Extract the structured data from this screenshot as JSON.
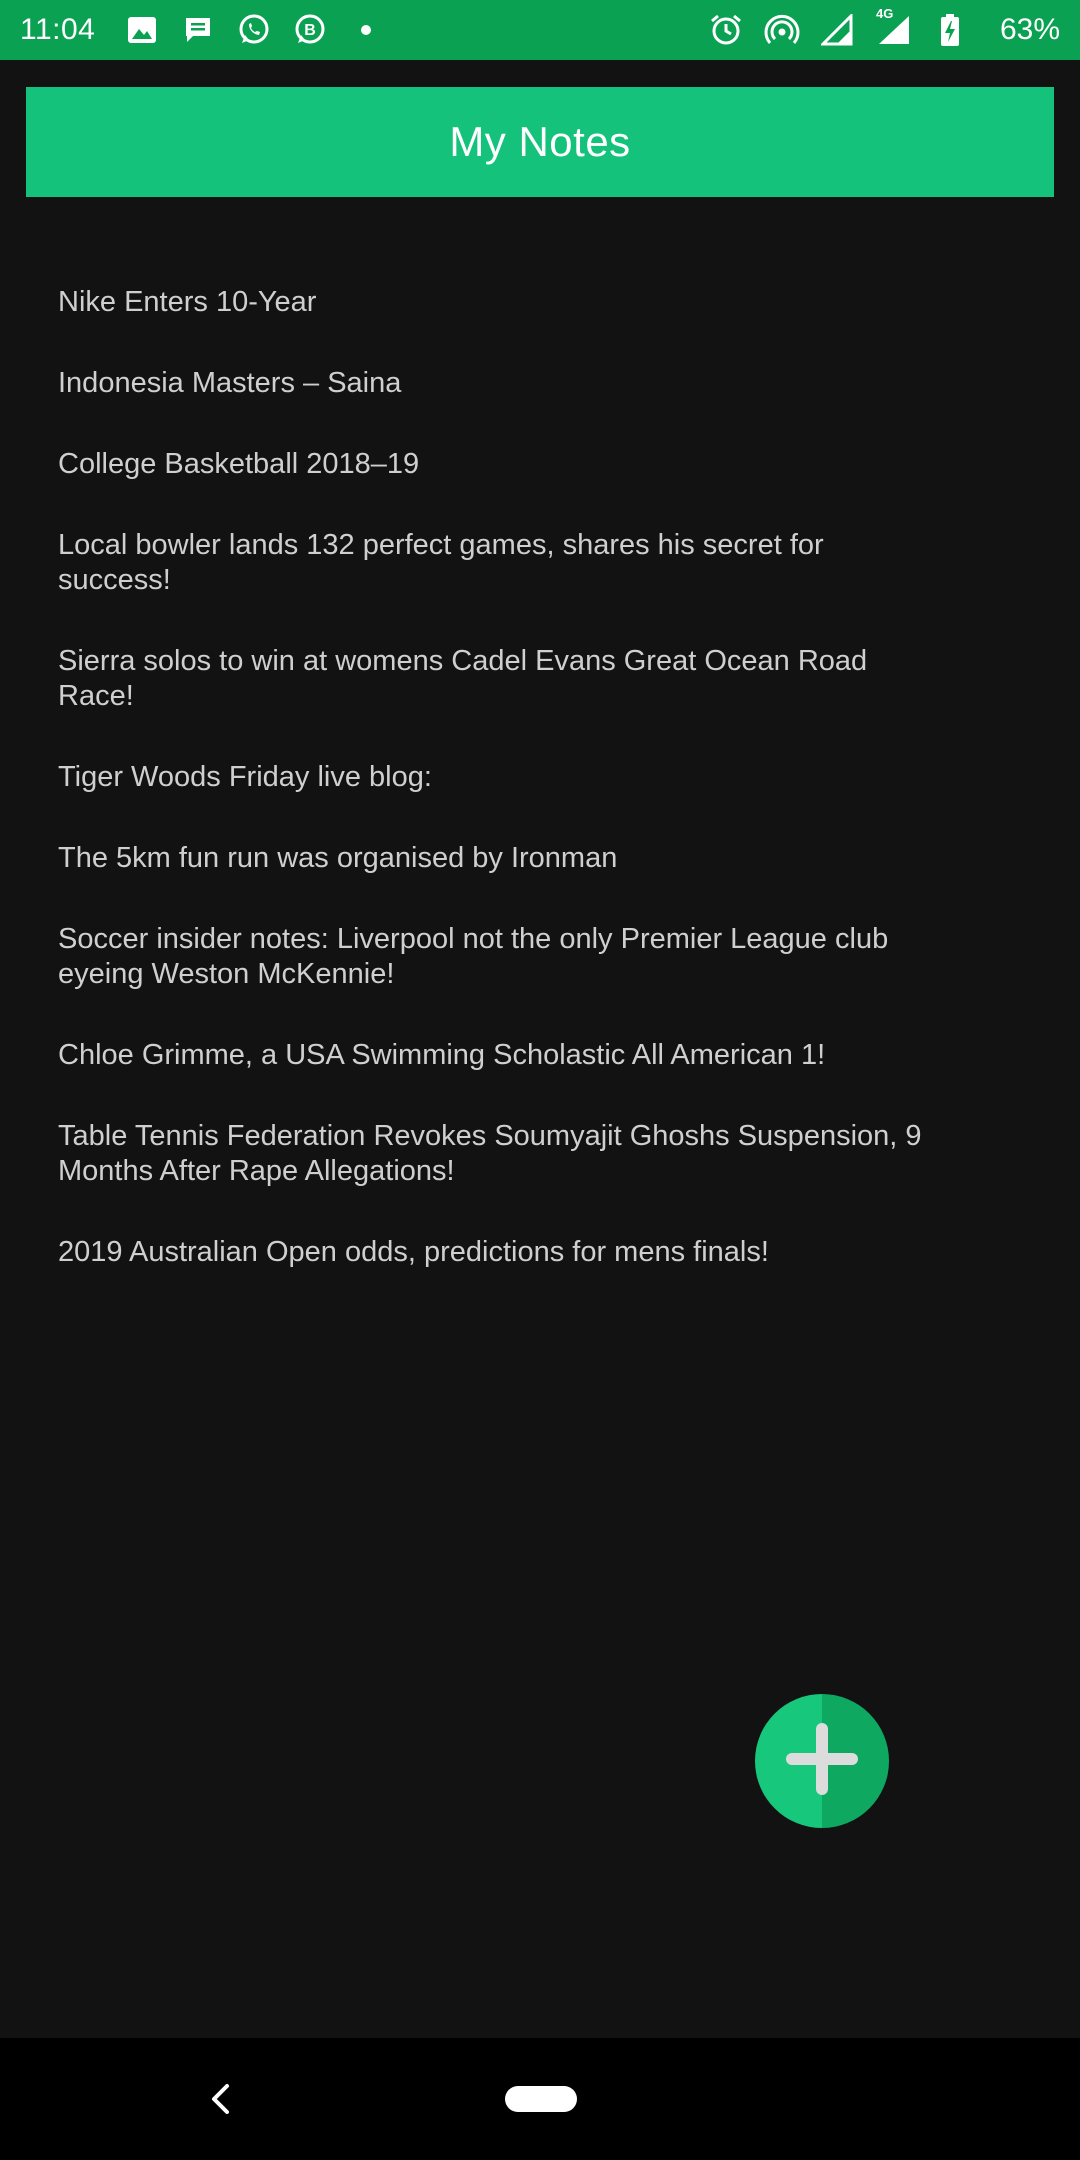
{
  "status_bar": {
    "time": "11:04",
    "battery_percent": "63%",
    "network": "4G",
    "left_icons": [
      "gallery-icon",
      "messages-icon",
      "whatsapp-icon",
      "business-icon",
      "dot-icon"
    ],
    "right_icons": [
      "alarm-icon",
      "hotspot-icon",
      "signal-icon",
      "signal-4g-icon",
      "battery-charging-icon"
    ],
    "color": "#0aa153"
  },
  "header": {
    "title": "My Notes",
    "color": "#14c27b"
  },
  "notes": [
    "Nike Enters 10-Year",
    "Indonesia Masters – Saina",
    "College Basketball 2018–19",
    "Local bowler lands 132 perfect games, shares his secret for success!",
    "Sierra solos to win at womens Cadel Evans Great Ocean Road Race!",
    "Tiger Woods Friday live blog:",
    "The 5km fun run was organised by Ironman",
    "Soccer insider notes: Liverpool not the only Premier League club eyeing Weston McKennie!",
    "Chloe Grimme, a USA Swimming Scholastic All American 1!",
    "Table Tennis Federation Revokes Soumyajit Ghoshs Suspension, 9 Months After Rape Allegations!",
    "2019 Australian Open odds, predictions for mens finals!"
  ],
  "fab": {
    "icon": "plus-icon",
    "color": "#17c77b"
  },
  "nav_bar": {
    "back_icon": "back-chevron-icon",
    "home_icon": "home-pill-icon"
  }
}
